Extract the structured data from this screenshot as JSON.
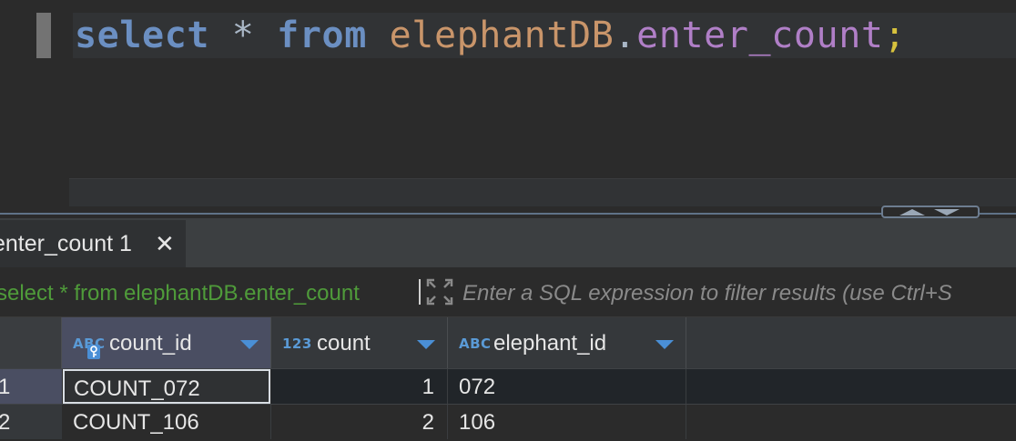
{
  "editor": {
    "sql": {
      "kw_select": "select",
      "star": "*",
      "kw_from": "from",
      "schema": "elephantDB",
      "dot": ".",
      "table": "enter_count",
      "semicolon": ";"
    }
  },
  "results": {
    "tab": {
      "label": "enter_count 1",
      "close_glyph": "✕"
    },
    "filter": {
      "query_text": "select * from elephantDB.enter_count",
      "placeholder": "Enter a SQL expression to filter results (use Ctrl+S"
    },
    "columns": [
      {
        "type_icon": "ABC",
        "name": "count_id",
        "icon": "abc-key-icon"
      },
      {
        "type_icon": "123",
        "name": "count",
        "icon": "numeric-icon"
      },
      {
        "type_icon": "ABC",
        "name": "elephant_id",
        "icon": "abc-icon"
      }
    ],
    "rows": [
      {
        "num": "1",
        "count_id": "COUNT_072",
        "count": "1",
        "elephant_id": "072"
      },
      {
        "num": "2",
        "count_id": "COUNT_106",
        "count": "2",
        "elephant_id": "106"
      }
    ]
  },
  "colors": {
    "keyword": "#6b8fc2",
    "schema": "#c9956a",
    "table": "#b07fc7",
    "semicolon": "#d7c23d",
    "query_text": "#4f9b3a",
    "sort_arrow": "#4a8fd6",
    "type_icon": "#5a9ad6"
  }
}
